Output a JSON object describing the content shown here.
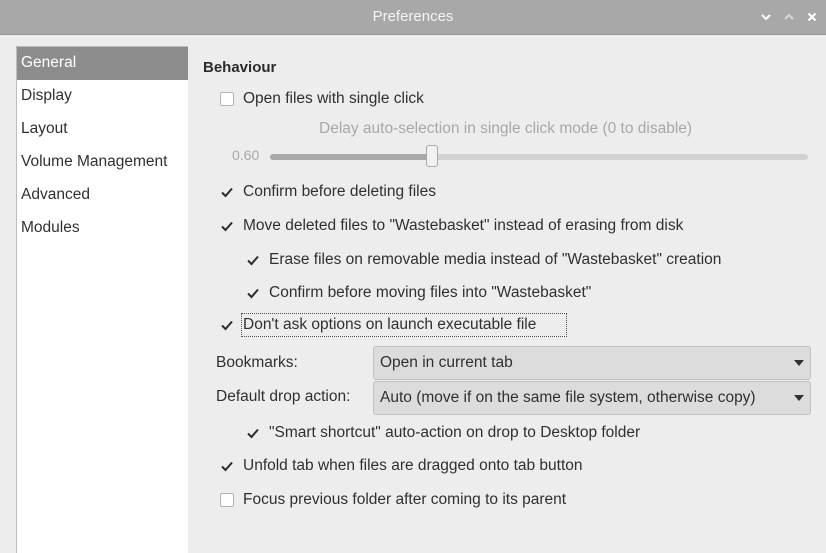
{
  "window": {
    "title": "Preferences"
  },
  "sidebar": {
    "items": [
      {
        "label": "General",
        "selected": true
      },
      {
        "label": "Display"
      },
      {
        "label": "Layout"
      },
      {
        "label": "Volume Management"
      },
      {
        "label": "Advanced"
      },
      {
        "label": "Modules"
      }
    ]
  },
  "behaviour": {
    "title": "Behaviour",
    "single_click": {
      "label": "Open files with single click",
      "checked": false
    },
    "delay_label": "Delay auto-selection in single click mode (0 to disable)",
    "delay_value_text": "0.60",
    "delay_fraction": 0.3,
    "confirm_delete": {
      "label": "Confirm before deleting files",
      "checked": true
    },
    "move_to_trash": {
      "label": "Move deleted files to \"Wastebasket\" instead of erasing from disk",
      "checked": true
    },
    "erase_removable": {
      "label": "Erase files on removable media instead of \"Wastebasket\" creation",
      "checked": true
    },
    "confirm_trash": {
      "label": "Confirm before moving files into \"Wastebasket\"",
      "checked": true
    },
    "no_exec_prompt": {
      "label": "Don't ask options on launch executable file",
      "checked": true
    },
    "bookmarks": {
      "label": "Bookmarks:",
      "value": "Open in current tab"
    },
    "drop_action": {
      "label": "Default drop action:",
      "value": "Auto (move if on the same file system, otherwise copy)"
    },
    "smart_shortcut": {
      "label": "\"Smart shortcut\" auto-action on drop to Desktop folder",
      "checked": true
    },
    "unfold_tab": {
      "label": "Unfold tab when files are dragged onto tab button",
      "checked": true
    },
    "focus_previous": {
      "label": "Focus previous folder after coming to its parent",
      "checked": false
    }
  },
  "colors": {
    "titlebar": "#a8a8a8",
    "selection": "#8c8c8c",
    "disabled_text": "#a8a8a8"
  }
}
